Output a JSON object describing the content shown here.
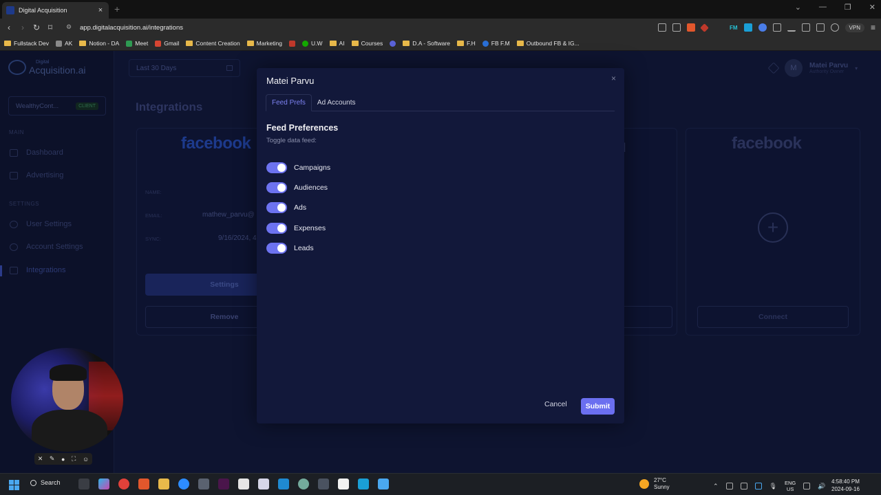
{
  "browser": {
    "tab_title": "Digital Acquisition",
    "url": "app.digitalacquisition.ai/integrations",
    "vpn_label": "VPN",
    "fm_label": "FM",
    "bookmarks": [
      "Fullstack Dev",
      "AK",
      "Notion - DA",
      "Meet",
      "Gmail",
      "Content Creation",
      "Marketing",
      "U.W",
      "AI",
      "Courses",
      "D.A - Software",
      "F.H",
      "FB F.M",
      "Outbound FB & IG..."
    ]
  },
  "app": {
    "logo_small": "Digital",
    "logo_text": "Acquisition.ai",
    "client_name": "WealthyCont...",
    "client_badge": "CLIENT",
    "sections": {
      "main": "MAIN",
      "settings": "SETTINGS"
    },
    "nav": {
      "dashboard": "Dashboard",
      "advertising": "Advertising",
      "user_settings": "User Settings",
      "account_settings": "Account Settings",
      "integrations": "Integrations"
    },
    "date_range": "Last 30 Days",
    "page_title": "Integrations",
    "user": {
      "initial": "M",
      "name": "Matei Parvu",
      "role": "Authority Owner"
    }
  },
  "cards": {
    "facebook_wordmark": "facebook",
    "pixel_partial": "el",
    "name_label": "NAME:",
    "email_label": "EMAIL:",
    "email_value": "mathew_parvu@",
    "sync_label": "SYNC:",
    "sync_value": "9/16/2024, 4",
    "settings_btn": "Settings",
    "remove_btn": "Remove",
    "connect_btn": "Connect"
  },
  "modal": {
    "title": "Matei Parvu",
    "close": "×",
    "tabs": [
      {
        "label": "Feed Prefs",
        "active": true
      },
      {
        "label": "Ad Accounts",
        "active": false
      }
    ],
    "section_title": "Feed Preferences",
    "section_subtitle": "Toggle data feed:",
    "toggles": [
      {
        "label": "Campaigns",
        "on": true
      },
      {
        "label": "Audiences",
        "on": true
      },
      {
        "label": "Ads",
        "on": true
      },
      {
        "label": "Expenses",
        "on": true
      },
      {
        "label": "Leads",
        "on": true
      }
    ],
    "cancel": "Cancel",
    "submit": "Submit"
  },
  "taskbar": {
    "search": "Search",
    "temperature": "27°C",
    "weather": "Sunny",
    "lang_top": "ENG",
    "lang_bottom": "US",
    "time": "4:58:40 PM",
    "date": "2024-09-16"
  },
  "colors": {
    "accent": "#6b6ff0",
    "modal_bg": "#12183a",
    "page_bg": "#0e1430"
  }
}
